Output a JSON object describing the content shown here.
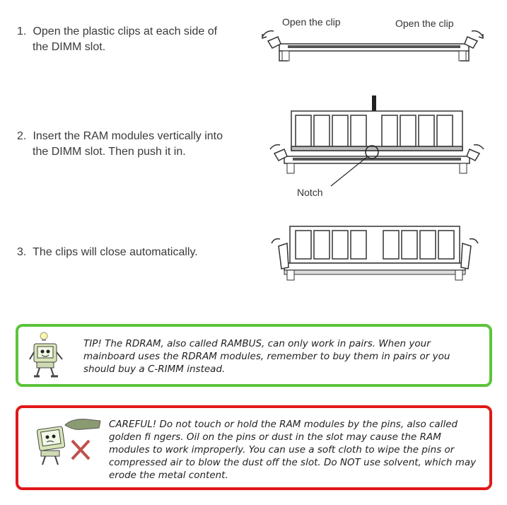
{
  "steps": [
    {
      "number": "1.",
      "line1": "Open the plastic clips at each side of",
      "line2": "the DIMM slot."
    },
    {
      "number": "2.",
      "line1": "Insert the RAM modules vertically into",
      "line2": "the DIMM slot. Then push it in."
    },
    {
      "number": "3.",
      "line1": "The clips will close automatically.",
      "line2": ""
    }
  ],
  "figures": {
    "clip_label_left": "Open the clip",
    "clip_label_right": "Open the clip",
    "notch_label": "Notch"
  },
  "tip": {
    "text": "TIP! The RDRAM, also called RAMBUS, can only work in pairs. When your mainboard uses the RDRAM modules, remember to buy them in pairs or you should buy a C-RIMM instead.",
    "border_color": "#5cc43a",
    "icon": "computer-mascot-lightbulb-icon"
  },
  "careful": {
    "text": "CAREFUL! Do not touch or hold the RAM modules by the pins, also called golden fi ngers. Oil on the pins or dust in the slot may cause the RAM modules to work improperly. You can use a soft cloth to wipe the pins or compressed air to blow the dust off the slot. Do NOT use solvent, which may erode the metal content.",
    "border_color": "#e01818",
    "icon": "computer-mascot-no-touch-icon"
  }
}
